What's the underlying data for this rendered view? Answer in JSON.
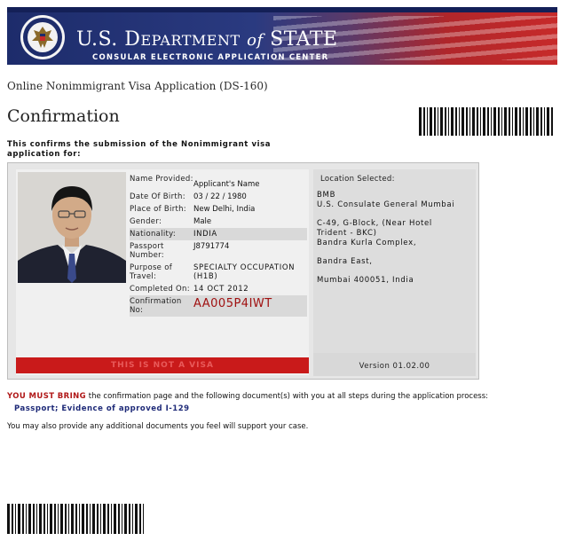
{
  "header": {
    "title_part1": "U.S. D",
    "title_part2": "EPARTMENT",
    "title_of": "of",
    "title_part3": "STATE",
    "subtitle": "CONSULAR ELECTRONIC APPLICATION CENTER",
    "seal_icon": "department-of-state-seal",
    "colors": {
      "blue": "#1d2c6b",
      "red": "#c72a2a"
    }
  },
  "form_name": "Online Nonimmigrant Visa Application (DS-160)",
  "page_title": "Confirmation",
  "intro": "This confirms the submission of the Nonimmigrant visa application for:",
  "applicant": {
    "fields": [
      {
        "label": "Name Provided:",
        "value": "Applicant's Name"
      },
      {
        "label": "Date Of Birth:",
        "value": "03 / 22 / 1980"
      },
      {
        "label": "Place of Birth:",
        "value": "New Delhi, India"
      },
      {
        "label": "Gender:",
        "value": "Male"
      },
      {
        "label": "Nationality:",
        "value": "INDIA"
      },
      {
        "label": "Passport Number:",
        "value": "J8791774"
      },
      {
        "label": "Purpose of Travel:",
        "value": "SPECIALTY OCCUPATION (H1B)"
      },
      {
        "label": "Completed On:",
        "value": "14 OCT 2012"
      },
      {
        "label": "Confirmation No:",
        "value": "AA005P4IWT"
      }
    ],
    "notice": "THIS IS NOT A VISA"
  },
  "location": {
    "label": "Location Selected:",
    "lines": [
      "BMB",
      "U.S. Consulate General Mumbai",
      "C-49, G-Block, (Near Hotel",
      "Trident - BKC)",
      "Bandra Kurla Complex,",
      "Bandra East,",
      "Mumbai 400051, India"
    ],
    "version": "Version 01.02.00"
  },
  "instructions": {
    "must_bring_strong": "YOU MUST BRING",
    "must_bring_rest": " the confirmation page and the following document(s) with you at all steps during the application process:",
    "documents": "Passport; Evidence of approved I-129",
    "additional": "You may also provide any additional documents you feel will support your case."
  }
}
